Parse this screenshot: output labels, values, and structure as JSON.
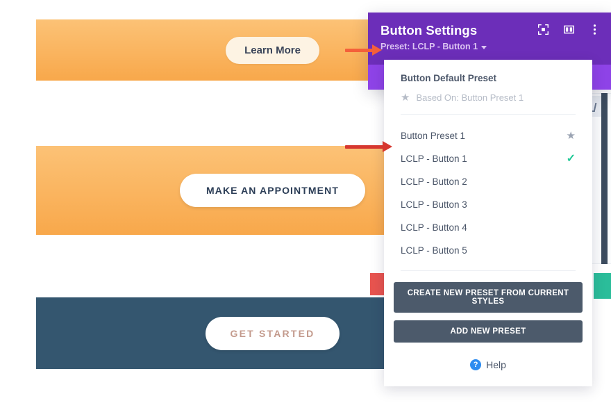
{
  "page": {
    "sections": [
      {
        "name": "orange-hero-1",
        "button_label": "Learn More",
        "bg_from": "#fcc276",
        "bg_to": "#f8a84b"
      },
      {
        "name": "orange-hero-2",
        "button_label": "MAKE AN APPOINTMENT",
        "bg_from": "#fcc276",
        "bg_to": "#f8a84b"
      },
      {
        "name": "dark-cta",
        "button_label": "GET STARTED",
        "bg": "#34566f"
      }
    ]
  },
  "modal": {
    "title": "Button Settings",
    "preset_label": "Preset: LCLP - Button 1",
    "header_bg": "#6c2eb9",
    "body_bg": "#8e43e7",
    "icons": [
      {
        "name": "focus-target-icon"
      },
      {
        "name": "layout-columns-icon"
      },
      {
        "name": "more-options-icon"
      }
    ]
  },
  "dropdown": {
    "default_preset": {
      "title": "Button Default Preset",
      "based_on": "Based On: Button Preset 1"
    },
    "items": [
      {
        "label": "Button Preset 1",
        "marker": "star",
        "selected": false
      },
      {
        "label": "LCLP - Button 1",
        "marker": "check",
        "selected": true
      },
      {
        "label": "LCLP - Button 2",
        "marker": "none",
        "selected": false
      },
      {
        "label": "LCLP - Button 3",
        "marker": "none",
        "selected": false
      },
      {
        "label": "LCLP - Button 4",
        "marker": "none",
        "selected": false
      },
      {
        "label": "LCLP - Button 5",
        "marker": "none",
        "selected": false
      }
    ],
    "actions": [
      {
        "label": "CREATE NEW PRESET FROM CURRENT STYLES"
      },
      {
        "label": "ADD NEW PRESET"
      }
    ],
    "help_label": "Help",
    "check_color": "#20c997",
    "button_bg": "#4c5a6b"
  },
  "annotations": [
    {
      "name": "arrow-to-preset-label",
      "color": "#f4603a"
    },
    {
      "name": "arrow-to-selected-preset",
      "color": "#d6372f"
    }
  ]
}
